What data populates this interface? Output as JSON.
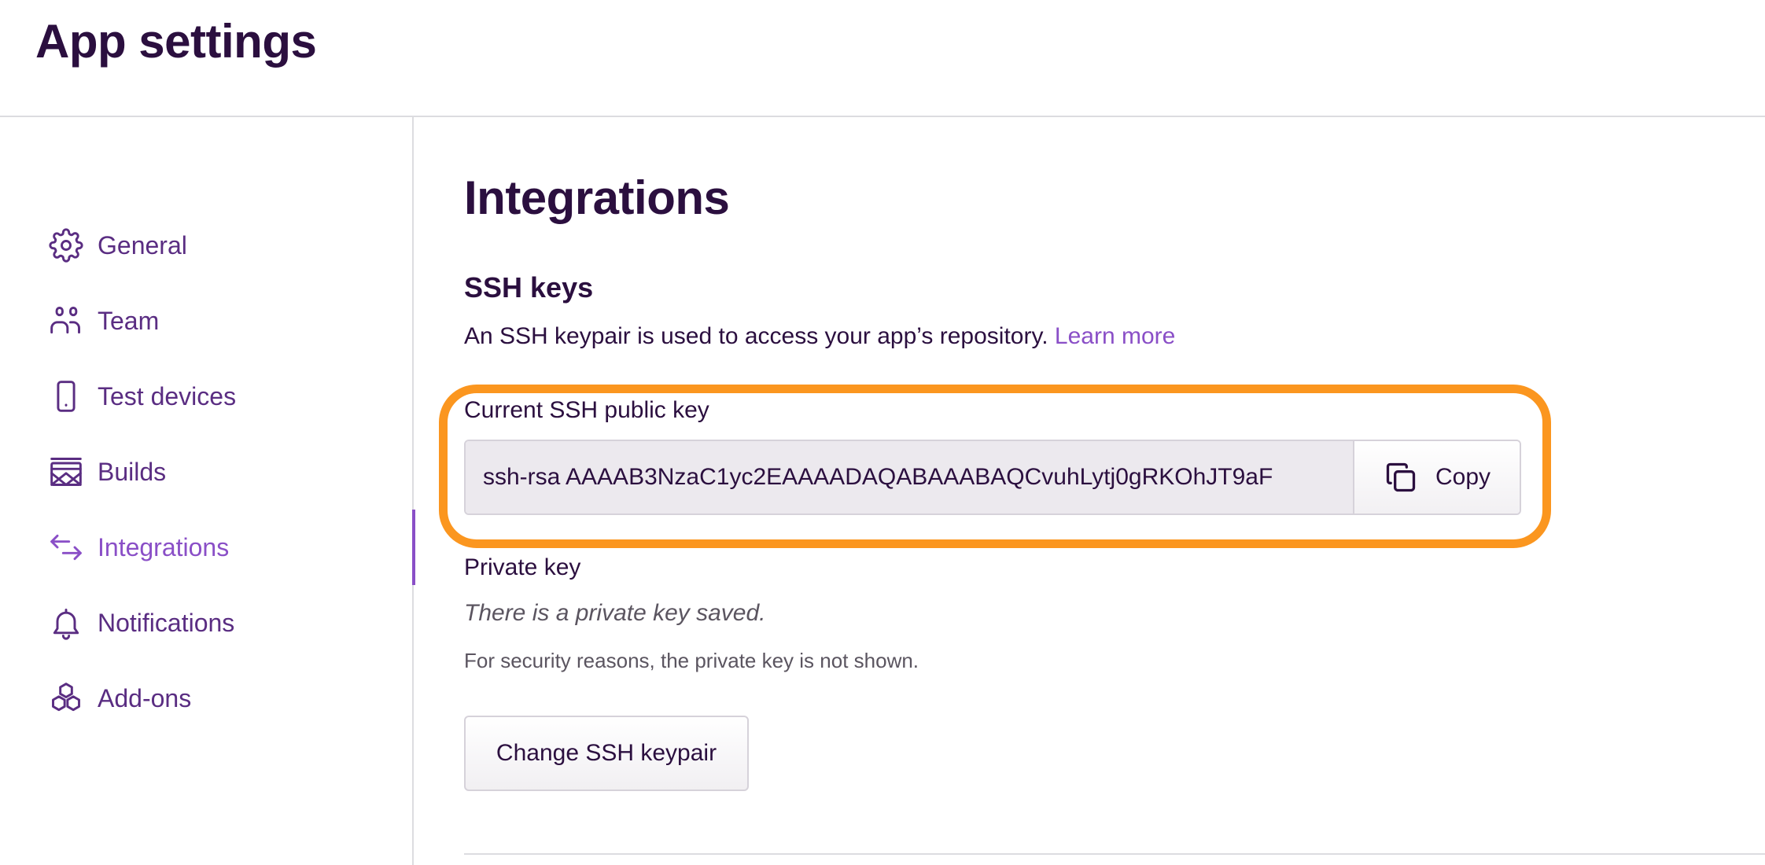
{
  "header": {
    "title": "App settings"
  },
  "sidebar": {
    "items": [
      {
        "label": "General",
        "icon": "gear-icon",
        "active": false
      },
      {
        "label": "Team",
        "icon": "team-icon",
        "active": false
      },
      {
        "label": "Test devices",
        "icon": "phone-icon",
        "active": false
      },
      {
        "label": "Builds",
        "icon": "builds-icon",
        "active": false
      },
      {
        "label": "Integrations",
        "icon": "arrows-exchange-icon",
        "active": true
      },
      {
        "label": "Notifications",
        "icon": "bell-icon",
        "active": false
      },
      {
        "label": "Add-ons",
        "icon": "hexagons-icon",
        "active": false
      }
    ]
  },
  "main": {
    "title": "Integrations",
    "ssh": {
      "title": "SSH keys",
      "description": "An SSH keypair is used to access your app’s repository.",
      "learn_more": "Learn more",
      "public_key_label": "Current SSH public key",
      "public_key_value": "ssh-rsa AAAAB3NzaC1yc2EAAAADAQABAAABAQCvuhLytj0gRKOhJT9aF",
      "copy_label": "Copy",
      "private_key_label": "Private key",
      "private_key_note": "There is a private key saved.",
      "security_note": "For security reasons, the private key is not shown.",
      "change_button": "Change SSH keypair"
    }
  },
  "colors": {
    "text_primary": "#2b0f3f",
    "nav_text": "#5a2d82",
    "accent": "#8a4fc7",
    "highlight": "#fb961f",
    "divider": "#dcdce0"
  }
}
